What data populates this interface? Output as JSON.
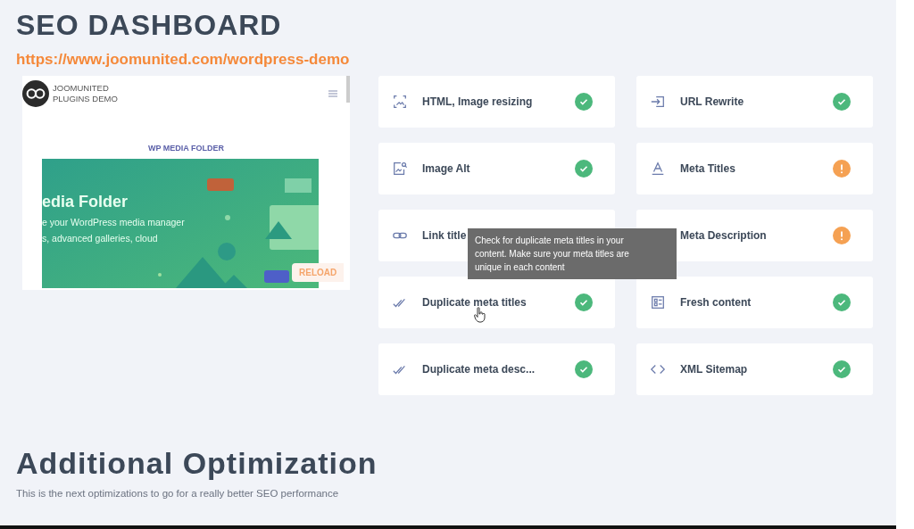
{
  "title": "SEO DASHBOARD",
  "url": "https://www.joomunited.com/wordpress-demo",
  "preview": {
    "brand_line_1": "JOOMUNITED",
    "brand_line_2": "PLUGINS DEMO",
    "heading": "WP MEDIA FOLDER",
    "banner_title": "edia Folder",
    "banner_line_1": "e your WordPress media manager",
    "banner_line_2": "s, advanced galleries, cloud",
    "reload": "RELOAD"
  },
  "checks": [
    {
      "label": "HTML, Image resizing",
      "kind": "resize",
      "ok": true
    },
    {
      "label": "URL Rewrite",
      "kind": "rewrite",
      "ok": true
    },
    {
      "label": "Image Alt",
      "kind": "alt",
      "ok": true
    },
    {
      "label": "Meta Titles",
      "kind": "font",
      "ok": false
    },
    {
      "label": "Link title",
      "kind": "link"
    },
    {
      "label": "Meta Description",
      "ok": false
    },
    {
      "label": "Duplicate meta titles",
      "kind": "duplicate",
      "ok": true
    },
    {
      "label": "Fresh content",
      "kind": "fresh",
      "ok": true
    },
    {
      "label": "Duplicate meta desc...",
      "kind": "duplicate",
      "ok": true
    },
    {
      "label": "XML Sitemap",
      "kind": "code",
      "ok": true
    }
  ],
  "tooltip": "Check for duplicate meta titles in your content. Make sure your meta titles are unique in each content",
  "additional": {
    "title": "Additional Optimization",
    "subtitle": "This is the next optimizations to go for a really better SEO performance"
  }
}
